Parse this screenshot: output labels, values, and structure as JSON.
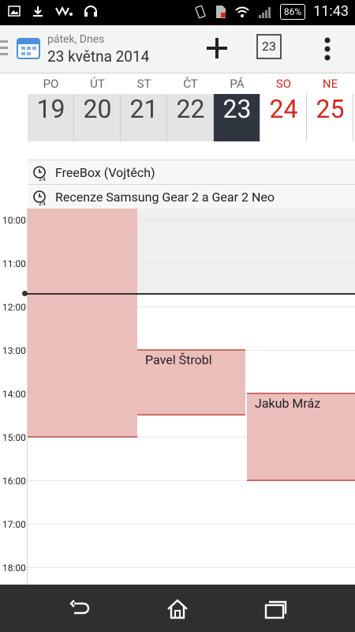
{
  "status": {
    "time": "11:43",
    "battery": "86%"
  },
  "header": {
    "subtitle": "pátek, Dnes",
    "title": "23 května 2014",
    "today_label": "23"
  },
  "week": {
    "days": [
      {
        "dow": "PO",
        "num": "19"
      },
      {
        "dow": "ÚT",
        "num": "20"
      },
      {
        "dow": "ST",
        "num": "21"
      },
      {
        "dow": "ČT",
        "num": "22"
      },
      {
        "dow": "PÁ",
        "num": "23"
      },
      {
        "dow": "SO",
        "num": "24"
      },
      {
        "dow": "NE",
        "num": "25"
      }
    ]
  },
  "all_day": [
    "FreeBox (Vojtěch)",
    "Recenze Samsung Gear 2 a Gear 2 Neo"
  ],
  "hours": [
    "10:00",
    "11:00",
    "12:00",
    "13:00",
    "14:00",
    "15:00",
    "16:00",
    "17:00",
    "18:00"
  ],
  "events": [
    {
      "label": ""
    },
    {
      "label": "Pavel Štrobl"
    },
    {
      "label": "Jakub Mráz"
    }
  ],
  "colors": {
    "accent_red": "#d9251c",
    "event_bg": "#ebbebb",
    "today_bg": "#2f3640"
  }
}
